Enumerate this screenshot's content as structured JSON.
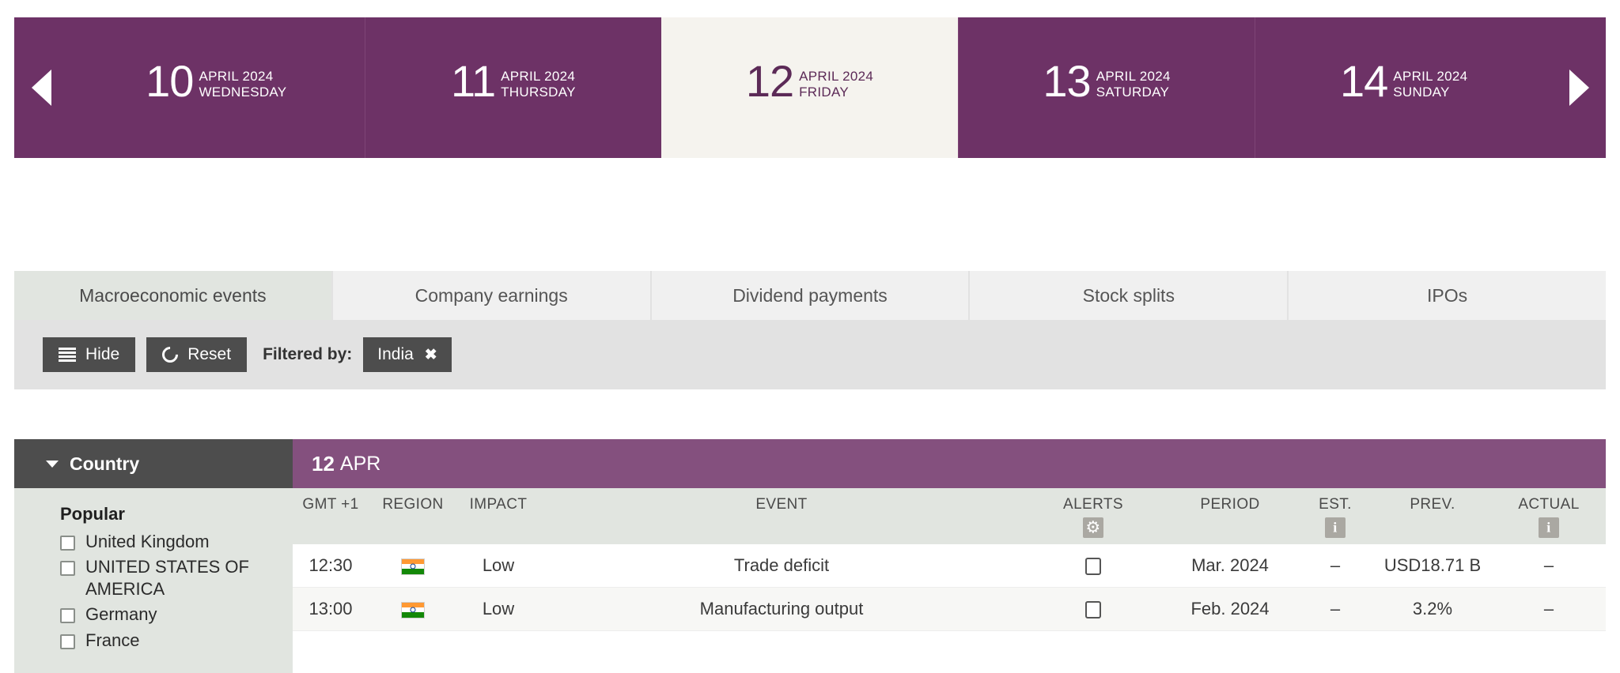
{
  "date_nav": {
    "prev_label": "previous",
    "next_label": "next",
    "days": [
      {
        "num": "10",
        "month": "APRIL 2024",
        "weekday": "WEDNESDAY",
        "selected": false
      },
      {
        "num": "11",
        "month": "APRIL 2024",
        "weekday": "THURSDAY",
        "selected": false
      },
      {
        "num": "12",
        "month": "APRIL 2024",
        "weekday": "FRIDAY",
        "selected": true
      },
      {
        "num": "13",
        "month": "APRIL 2024",
        "weekday": "SATURDAY",
        "selected": false
      },
      {
        "num": "14",
        "month": "APRIL 2024",
        "weekday": "SUNDAY",
        "selected": false
      }
    ]
  },
  "tabs": [
    {
      "label": "Macroeconomic events",
      "active": true
    },
    {
      "label": "Company earnings",
      "active": false
    },
    {
      "label": "Dividend payments",
      "active": false
    },
    {
      "label": "Stock splits",
      "active": false
    },
    {
      "label": "IPOs",
      "active": false
    }
  ],
  "toolbar": {
    "hide_label": "Hide",
    "reset_label": "Reset",
    "filtered_by_label": "Filtered by:",
    "chips": [
      {
        "label": "India",
        "close": "✖"
      }
    ]
  },
  "sidebar": {
    "header": "Country",
    "group_label": "Popular",
    "countries": [
      {
        "label": "United Kingdom",
        "checked": false
      },
      {
        "label": "UNITED STATES OF AMERICA",
        "checked": false
      },
      {
        "label": "Germany",
        "checked": false
      },
      {
        "label": "France",
        "checked": false
      }
    ]
  },
  "table": {
    "banner_day": "12",
    "banner_month": "APR",
    "columns": [
      {
        "key": "time",
        "label": "GMT +1",
        "icon": null
      },
      {
        "key": "region",
        "label": "REGION",
        "icon": null
      },
      {
        "key": "impact",
        "label": "IMPACT",
        "icon": null
      },
      {
        "key": "event",
        "label": "EVENT",
        "icon": null
      },
      {
        "key": "alerts",
        "label": "ALERTS",
        "icon": "gear-icon"
      },
      {
        "key": "period",
        "label": "PERIOD",
        "icon": null
      },
      {
        "key": "est",
        "label": "EST.",
        "icon": "info-icon"
      },
      {
        "key": "prev",
        "label": "PREV.",
        "icon": null
      },
      {
        "key": "actual",
        "label": "ACTUAL",
        "icon": "info-icon"
      }
    ],
    "rows": [
      {
        "time": "12:30",
        "region_flag": "india-flag",
        "impact": "Low",
        "event": "Trade deficit",
        "alert_checked": false,
        "period": "Mar. 2024",
        "est": "–",
        "prev": "USD18.71 B",
        "actual": "–"
      },
      {
        "time": "13:00",
        "region_flag": "india-flag",
        "impact": "Low",
        "event": "Manufacturing output",
        "alert_checked": false,
        "period": "Feb. 2024",
        "est": "–",
        "prev": "3.2%",
        "actual": "–"
      }
    ]
  },
  "colors": {
    "brand_purple": "#6d3266",
    "banner_purple": "#84507e",
    "selected_day_bg": "#f5f3ee",
    "toolbar_bg": "#e2e2e2",
    "dark_control": "#4d4d4d",
    "panel_gray": "#e1e5e0"
  }
}
